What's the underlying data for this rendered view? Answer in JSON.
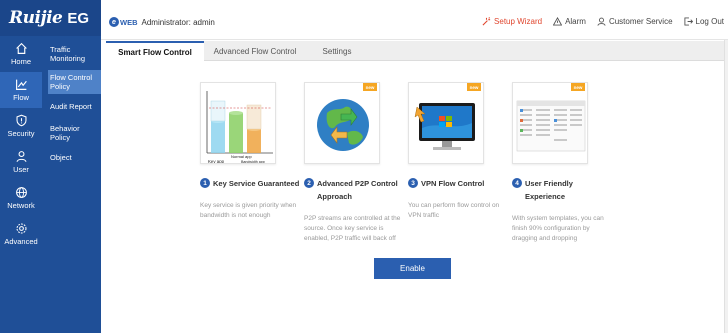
{
  "brand": {
    "logo_main": "Ruijie",
    "logo_product": "EG"
  },
  "sidebar": {
    "icons": [
      {
        "label": "Home",
        "icon": "home-icon"
      },
      {
        "label": "Flow",
        "icon": "flow-chart-icon"
      },
      {
        "label": "Security",
        "icon": "shield-icon"
      },
      {
        "label": "User",
        "icon": "user-icon"
      },
      {
        "label": "Network",
        "icon": "globe-icon"
      },
      {
        "label": "Advanced",
        "icon": "gear-icon"
      }
    ],
    "menu": [
      {
        "label": "Traffic Monitoring"
      },
      {
        "label": "Flow Control Policy"
      },
      {
        "label": "Audit Report"
      },
      {
        "label": "Behavior Policy"
      },
      {
        "label": "Object"
      }
    ]
  },
  "header": {
    "web_logo": "WEB",
    "admin_text": "Administrator: admin",
    "actions": [
      {
        "label": "Setup Wizard",
        "icon": "wizard-icon"
      },
      {
        "label": "Alarm",
        "icon": "alarm-icon"
      },
      {
        "label": "Customer Service",
        "icon": "customer-service-icon"
      },
      {
        "label": "Log Out",
        "icon": "logout-icon"
      }
    ]
  },
  "tabs": [
    {
      "label": "Smart Flow Control"
    },
    {
      "label": "Advanced Flow Control"
    },
    {
      "label": "Settings"
    }
  ],
  "features": [
    {
      "number": "1",
      "title": "Key Service Guaranteed",
      "desc": "Key service is given priority when bandwidth is not enough",
      "badge": "",
      "chart_labels": {
        "a": "Normal app",
        "b": "Key app",
        "c": "Bandwidth app"
      }
    },
    {
      "number": "2",
      "title": "Advanced P2P Control Approach",
      "desc": "P2P streams are controlled at the source. Once key service is enabled, P2P traffic will back off",
      "badge": "new"
    },
    {
      "number": "3",
      "title": "VPN Flow Control",
      "desc": "You can perform flow control on VPN traffic",
      "badge": "new"
    },
    {
      "number": "4",
      "title": "User Friendly Experience",
      "desc": "With system templates, you can finish 90% configuration by dragging and dropping",
      "badge": "new"
    }
  ],
  "enable_label": "Enable",
  "colors": {
    "sidebar": "#1f4f97",
    "accent": "#2b5fb0",
    "badge": "#f5a623",
    "wizard": "#e0462e"
  }
}
